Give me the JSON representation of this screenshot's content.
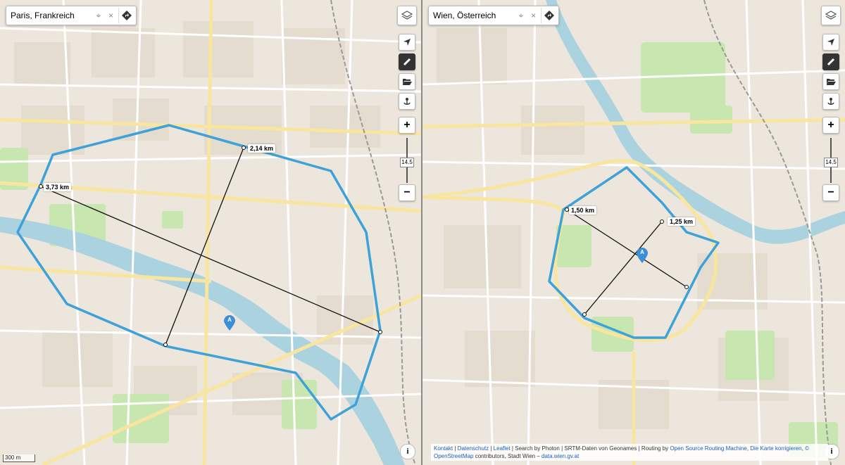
{
  "left_map": {
    "search_value": "Paris, Frankreich",
    "distance_labels": [
      "3,73 km",
      "2,14 km"
    ],
    "marker_label": "A",
    "zoom_level": "14.5",
    "scale_label": "300 m",
    "zoom_in": "+",
    "zoom_out": "−",
    "clear": "×",
    "info": "i"
  },
  "right_map": {
    "search_value": "Wien, Österreich",
    "distance_labels": [
      "1,50 km",
      "1,25 km"
    ],
    "marker_label": "A",
    "zoom_level": "14.5",
    "zoom_in": "+",
    "zoom_out": "−",
    "clear": "×",
    "info": "i"
  },
  "attribution": {
    "kontakt": "Kontakt",
    "datenschutz": "Datenschutz",
    "leaflet": "Leaflet",
    "photon": "Search by Photon",
    "srtm": "SRTM-Daten von Geonames",
    "routing_prefix": "Routing by",
    "osrm": "Open Source Routing Machine",
    "korrigieren": "Die Karte korrigieren",
    "copyright": "© OpenStreetMap",
    "contributors": "contributors, Stadt Wien –",
    "data_source": "data.wien.gv.at"
  },
  "colors": {
    "polygon": "#3da2d8",
    "measure_line": "#111111",
    "marker": "#3b8fd6",
    "water": "#aad3df",
    "park": "#c8e6b0",
    "road": "#ffffff",
    "major_road": "#f7e5a0",
    "land": "#f2efe9"
  },
  "icons": [
    "layers-icon",
    "locate-arrow-icon",
    "ruler-icon",
    "folder-open-icon",
    "anchor-icon",
    "zoom-in-icon",
    "zoom-out-icon",
    "crosshair-icon",
    "close-icon",
    "route-diamond-icon",
    "info-icon",
    "map-marker-icon"
  ]
}
